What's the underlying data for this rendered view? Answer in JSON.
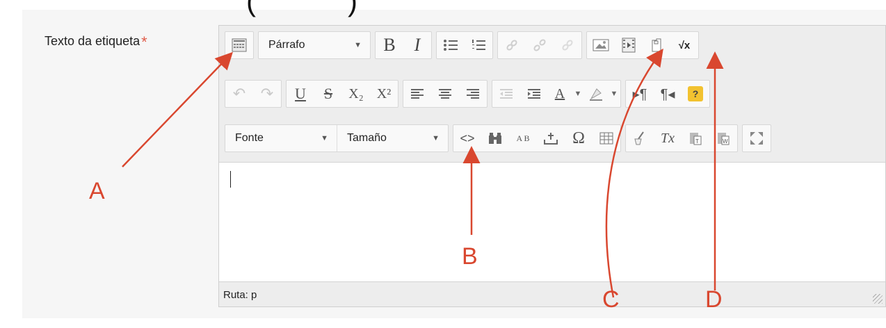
{
  "form": {
    "field_label": "Texto da etiqueta",
    "required_mark": "*"
  },
  "editor": {
    "format_select": "Párrafo",
    "font_select": "Fonte",
    "size_select": "Tamaño",
    "path_label": "Ruta: p"
  },
  "toolbar": {
    "bold": "B",
    "italic": "I",
    "underline": "U",
    "strike": "S",
    "subscript": "X₂",
    "superscript": "X²",
    "help": "?",
    "equation": "√x",
    "text_color": "A",
    "clear_format": "Tx",
    "charmap": "Ω",
    "find_replace_label": "A B",
    "code": "<>"
  },
  "annotations": {
    "a": "A",
    "b": "B",
    "c": "C",
    "d": "D",
    "color": "#d9472f"
  }
}
